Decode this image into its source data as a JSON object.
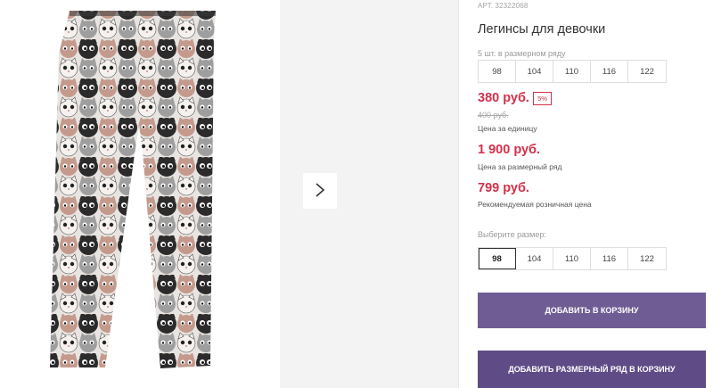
{
  "product": {
    "article_label": "АРТ.",
    "article_number": "32322068",
    "title": "Легинсы для девочки"
  },
  "size_row": {
    "label": "5 шт. в размерном ряду",
    "sizes": [
      "98",
      "104",
      "110",
      "116",
      "122"
    ]
  },
  "prices": {
    "unit_price": "380 руб.",
    "discount": "5%",
    "old_price": "400 руб.",
    "unit_caption": "Цена за единицу",
    "row_price": "1 900 руб.",
    "row_caption": "Цена за размерный ряд",
    "rrp_price": "799 руб.",
    "rrp_caption": "Рекомендуемая розничная цена"
  },
  "size_select": {
    "label": "Выберите размер:",
    "sizes": [
      "98",
      "104",
      "110",
      "116",
      "122"
    ],
    "selected": "98"
  },
  "actions": {
    "add_to_cart": "ДОБАВИТЬ В КОРЗИНУ",
    "add_row_to_cart": "ДОБАВИТЬ РАЗМЕРНЫЙ РЯД В КОРЗИНУ"
  },
  "icons": {
    "gallery_next": "chevron-right-icon"
  },
  "colors": {
    "price": "#d4314a",
    "button": "#6e5a94"
  }
}
